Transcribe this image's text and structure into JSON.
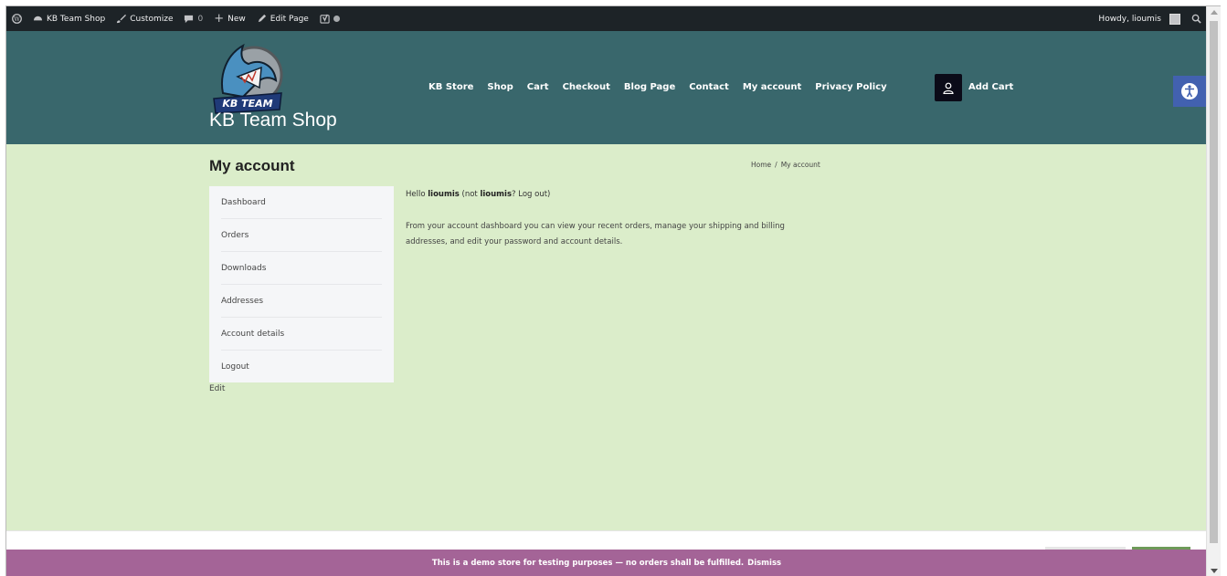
{
  "adminbar": {
    "site_name": "KB Team Shop",
    "customize": "Customize",
    "comments_count": "0",
    "new": "New",
    "edit_page": "Edit Page",
    "howdy": "Howdy, lioumis"
  },
  "header": {
    "logo_text": "KB TEAM",
    "site_title": "KB Team Shop",
    "nav": [
      "KB Store",
      "Shop",
      "Cart",
      "Checkout",
      "Blog Page",
      "Contact",
      "My account",
      "Privacy Policy"
    ],
    "cart_label": "Add Cart"
  },
  "page": {
    "title": "My account",
    "breadcrumb": [
      "Home",
      "/",
      "My account"
    ]
  },
  "account_nav": [
    "Dashboard",
    "Orders",
    "Downloads",
    "Addresses",
    "Account details",
    "Logout"
  ],
  "edit_label": "Edit",
  "dashboard": {
    "hello_prefix": "Hello ",
    "username": "lioumis",
    "not_prefix": " (not ",
    "username2": "lioumis",
    "not_suffix": "? ",
    "logout_link": "Log out",
    "close_paren": ")",
    "description": "From your account dashboard you can view your recent orders, manage your shipping and billing addresses, and edit your password and account details."
  },
  "notice": {
    "text": "This is a demo store for testing purposes — no orders shall be fulfilled.",
    "dismiss": "Dismiss"
  },
  "colors": {
    "header_bg": "#39676c",
    "content_bg": "#dbedca",
    "notice_bg": "#a46497",
    "a11y_bg": "#4261b0",
    "adminbar_bg": "#1d2327"
  }
}
